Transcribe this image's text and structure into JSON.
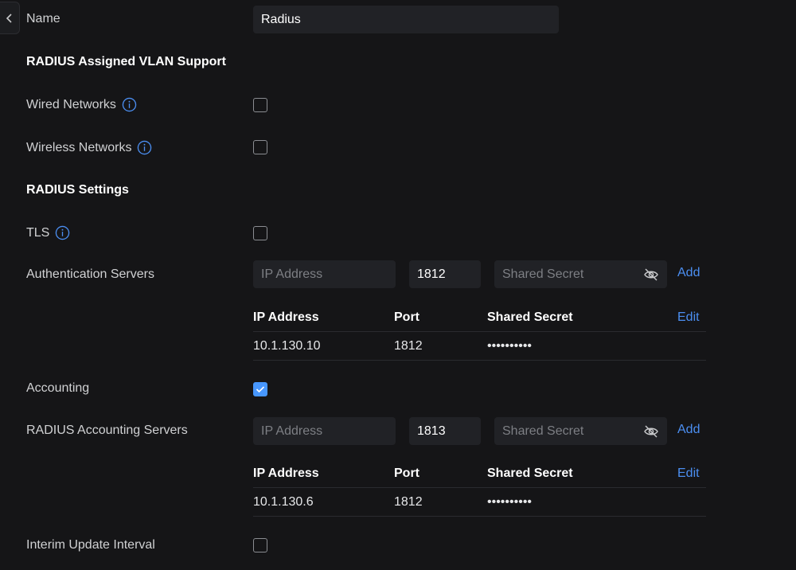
{
  "name_row": {
    "label": "Name",
    "value": "Radius"
  },
  "vlan_section": {
    "title": "RADIUS Assigned VLAN Support",
    "wired_label": "Wired Networks",
    "wireless_label": "Wireless Networks"
  },
  "settings_section": {
    "title": "RADIUS Settings",
    "tls_label": "TLS"
  },
  "auth_servers": {
    "label": "Authentication Servers",
    "ip_placeholder": "IP Address",
    "port_value": "1812",
    "secret_placeholder": "Shared Secret",
    "add_label": "Add",
    "columns": [
      "IP Address",
      "Port",
      "Shared Secret"
    ],
    "edit_label": "Edit",
    "rows": [
      {
        "ip": "10.1.130.10",
        "port": "1812",
        "secret": "••••••••••"
      }
    ]
  },
  "accounting": {
    "label": "Accounting",
    "checked": true
  },
  "acct_servers": {
    "label": "RADIUS Accounting Servers",
    "ip_placeholder": "IP Address",
    "port_value": "1813",
    "secret_placeholder": "Shared Secret",
    "add_label": "Add",
    "columns": [
      "IP Address",
      "Port",
      "Shared Secret"
    ],
    "edit_label": "Edit",
    "rows": [
      {
        "ip": "10.1.130.6",
        "port": "1812",
        "secret": "••••••••••"
      }
    ]
  },
  "interim": {
    "label": "Interim Update Interval"
  },
  "colors": {
    "accent": "#4797ff",
    "link": "#4b8ef1",
    "background": "#151517",
    "field": "#212226"
  }
}
